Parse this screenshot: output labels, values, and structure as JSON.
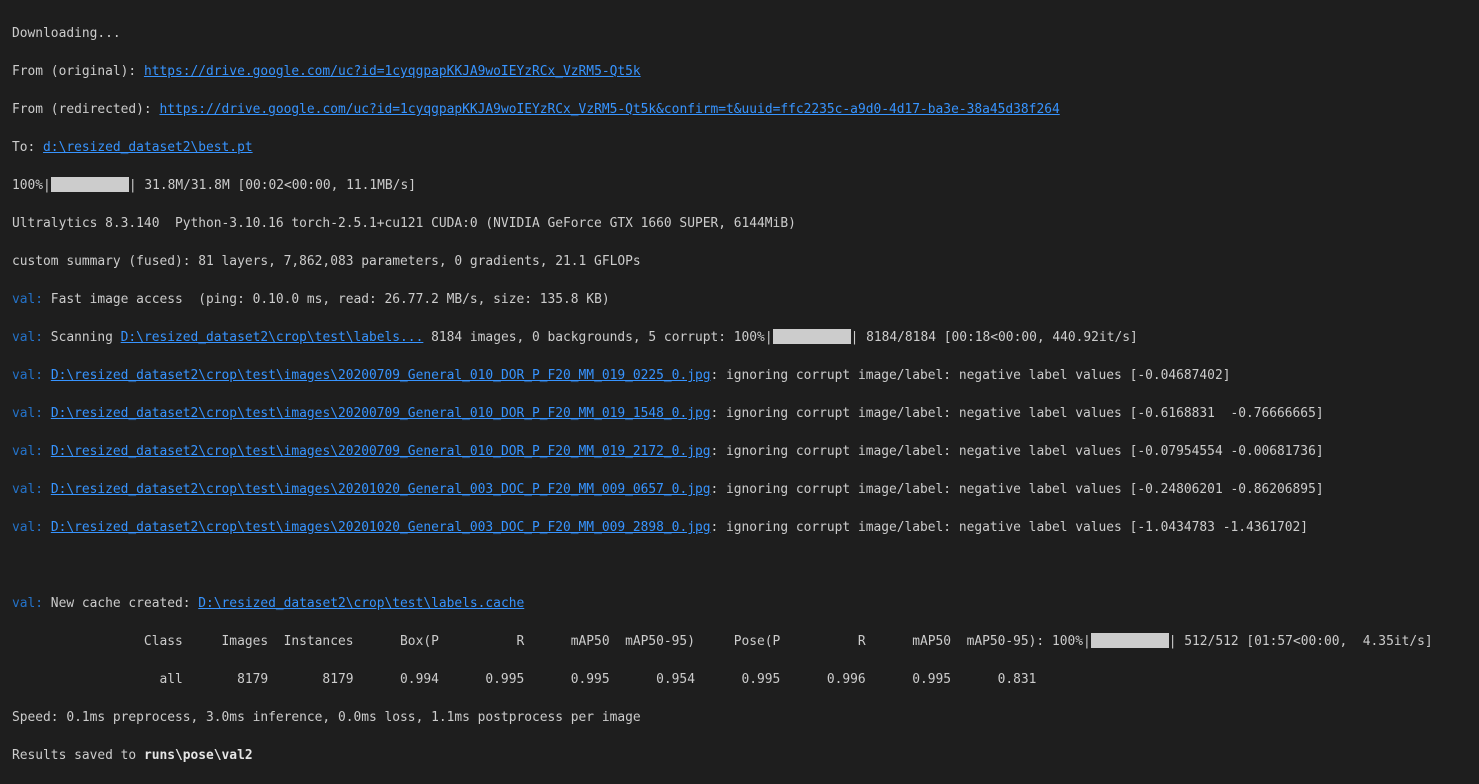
{
  "lines": {
    "l1": "Downloading...",
    "l2_prefix": "From (original): ",
    "l2_link": "https://drive.google.com/uc?id=1cyqgpapKKJA9woIEYzRCx_VzRM5-Qt5k",
    "l3_prefix": "From (redirected): ",
    "l3_link": "https://drive.google.com/uc?id=1cyqgpapKKJA9woIEYzRCx_VzRM5-Qt5k&confirm=t&uuid=ffc2235c-a9d0-4d17-ba3e-38a45d38f264",
    "l4_prefix": "To: ",
    "l4_link": "d:\\resized_dataset2\\best.pt",
    "l5_pct": "100%|",
    "l5_rest": "| 31.8M/31.8M [00:02<00:00, 11.1MB/s]",
    "l6": "Ultralytics 8.3.140  Python-3.10.16 torch-2.5.1+cu121 CUDA:0 (NVIDIA GeForce GTX 1660 SUPER, 6144MiB)",
    "l7": "custom summary (fused): 81 layers, 7,862,083 parameters, 0 gradients, 21.1 GFLOPs",
    "l8_tag": "val:",
    "l8_text": " Fast image access  (ping: 0.10.0 ms, read: 26.77.2 MB/s, size: 135.8 KB)",
    "l9_tag": "val:",
    "l9_text1": " Scanning ",
    "l9_link": "D:\\resized_dataset2\\crop\\test\\labels...",
    "l9_text2": " 8184 images, 0 backgrounds, 5 corrupt: 100%|",
    "l9_text3": "| 8184/8184 [00:18<00:00, 440.92it/s]",
    "corrupt": [
      {
        "tag": "val:",
        "link": "D:\\resized_dataset2\\crop\\test\\images\\20200709_General_010_DOR_P_F20_MM_019_0225_0.jpg",
        "text": ": ignoring corrupt image/label: negative label values [-0.04687402]"
      },
      {
        "tag": "val:",
        "link": "D:\\resized_dataset2\\crop\\test\\images\\20200709_General_010_DOR_P_F20_MM_019_1548_0.jpg",
        "text": ": ignoring corrupt image/label: negative label values [-0.6168831  -0.76666665]"
      },
      {
        "tag": "val:",
        "link": "D:\\resized_dataset2\\crop\\test\\images\\20200709_General_010_DOR_P_F20_MM_019_2172_0.jpg",
        "text": ": ignoring corrupt image/label: negative label values [-0.07954554 -0.00681736]"
      },
      {
        "tag": "val:",
        "link": "D:\\resized_dataset2\\crop\\test\\images\\20201020_General_003_DOC_P_F20_MM_009_0657_0.jpg",
        "text": ": ignoring corrupt image/label: negative label values [-0.24806201 -0.86206895]"
      },
      {
        "tag": "val:",
        "link": "D:\\resized_dataset2\\crop\\test\\images\\20201020_General_003_DOC_P_F20_MM_009_2898_0.jpg",
        "text": ": ignoring corrupt image/label: negative label values [-1.0434783 -1.4361702]"
      }
    ],
    "l16_tag": "val:",
    "l16_text": " New cache created: ",
    "l16_link": "D:\\resized_dataset2\\crop\\test\\labels.cache",
    "l17_header": "                 Class     Images  Instances      Box(P          R      mAP50  mAP50-95)     Pose(P          R      mAP50  mAP50-95): 100%|",
    "l17_rest": "| 512/512 [01:57<00:00,  4.35it/s]",
    "l18_row": "                   all       8179       8179      0.994      0.995      0.995      0.954      0.995      0.996      0.995      0.831",
    "l19": "Speed: 0.1ms preprocess, 3.0ms inference, 0.0ms loss, 1.1ms postprocess per image",
    "l20_prefix": "Results saved to ",
    "l20_bold": "runs\\pose\\val2"
  },
  "colors": {
    "background": "#1e1e1e",
    "text": "#cccccc",
    "link": "#3794ff",
    "val_tag": "#2472c8"
  }
}
